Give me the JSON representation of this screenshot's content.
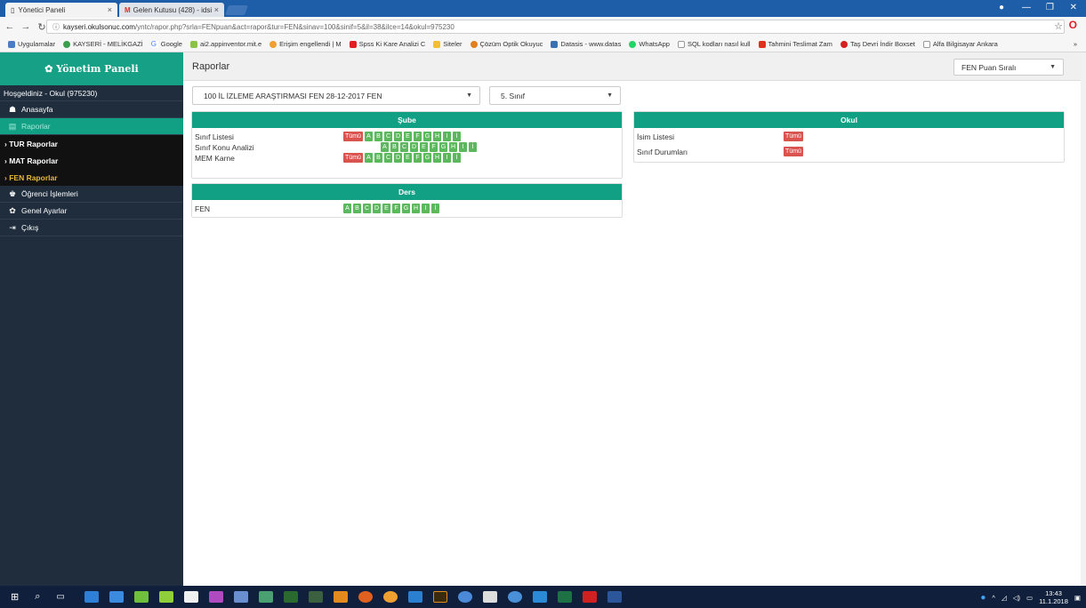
{
  "browser": {
    "tabs": [
      {
        "label": "Yönetici Paneli"
      },
      {
        "label": "Gelen Kutusu (428) - idsi"
      }
    ],
    "url": "kayseri.okulsonuc.com/yntc/rapor.php?srla=FENpuan&act=rapor&tur=FEN&sinav=100&sinif=5&il=38&ilce=14&okul=975230",
    "url_host": "kayseri.okulsonuc.com",
    "url_path": "/yntc/rapor.php?srla=FENpuan&act=rapor&tur=FEN&sinav=100&sinif=5&il=38&ilce=14&okul=975230",
    "bookmarks": [
      "Uygulamalar",
      "KAYSERİ - MELİKGAZİ",
      "Google",
      "ai2.appinventor.mit.e",
      "Erişim engellendi | M",
      "Spss Ki Kare Analizi C",
      "Siteler",
      "Çözüm Optik Okuyuc",
      "Datasis - www.datas",
      "WhatsApp",
      "SQL kodları nasıl kull",
      "Tahmini Teslimat Zam",
      "Taş Devri İndir Boxset",
      "Alfa Bilgisayar Ankara"
    ]
  },
  "sidebar": {
    "brand": "✿ Yönetim Paneli",
    "welcome": "Hoşgeldiniz - Okul (975230)",
    "items": [
      {
        "icon": "☗",
        "label": "Anasayfa"
      },
      {
        "icon": "▤",
        "label": "Raporlar"
      }
    ],
    "subitems": [
      "TUR Raporlar",
      "MAT Raporlar",
      "FEN Raporlar"
    ],
    "items2": [
      {
        "icon": "♚",
        "label": "Öğrenci İşlemleri"
      },
      {
        "icon": "✿",
        "label": "Genel Ayarlar"
      },
      {
        "icon": "⇥",
        "label": "Çıkış"
      }
    ]
  },
  "main": {
    "title": "Raporlar",
    "sort_select": "FEN Puan Sıralı",
    "exam_select": "100  İL İZLEME ARAŞTIRMASI FEN  28-12-2017  FEN",
    "class_select": "5. Sınıf",
    "sube_panel": {
      "title": "Şube",
      "rows": [
        {
          "label": "Sınıf Listesi",
          "all": "Tümü"
        },
        {
          "label": "Sınıf Konu Analizi",
          "all": ""
        },
        {
          "label": "MEM Karne",
          "all": "Tümü"
        }
      ]
    },
    "ders_panel": {
      "title": "Ders",
      "rows": [
        {
          "label": "FEN"
        }
      ]
    },
    "okul_panel": {
      "title": "Okul",
      "rows": [
        {
          "label": "İsim Listesi",
          "all": "Tümü"
        },
        {
          "label": "Sınıf Durumları",
          "all": "Tümü"
        }
      ]
    },
    "letters": [
      "A",
      "B",
      "C",
      "D",
      "E",
      "F",
      "G",
      "H",
      "I",
      "İ"
    ]
  },
  "taskbar": {
    "time": "13:43",
    "date": "11.1.2018"
  }
}
